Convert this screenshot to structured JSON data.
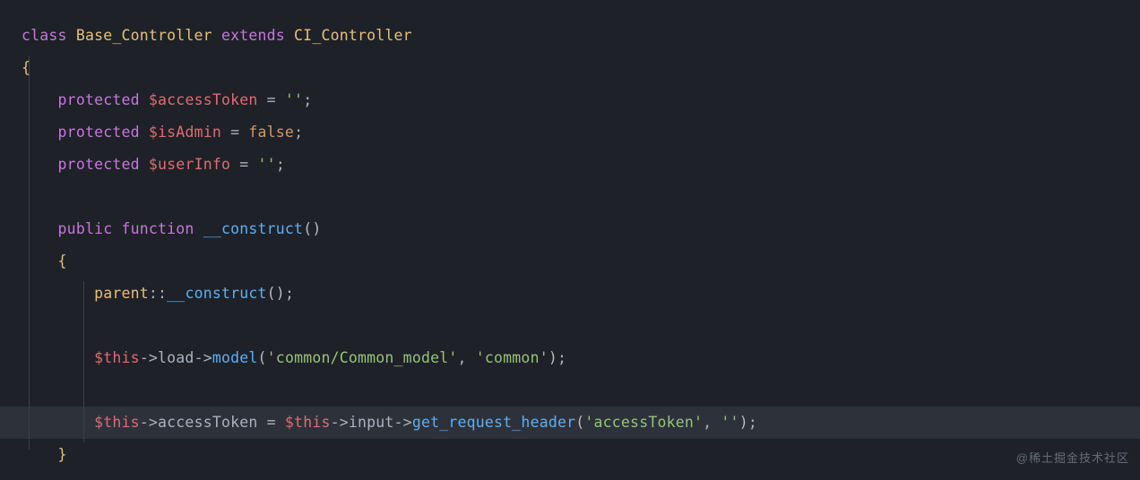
{
  "code": {
    "kw_class": "class",
    "class_name": "Base_Controller",
    "kw_extends": "extends",
    "parent_class": "CI_Controller",
    "brace_open": "{",
    "brace_close": "}",
    "props": {
      "p1_kw": "protected",
      "p1_var": "$accessToken",
      "p1_eq": " = ",
      "p1_val": "''",
      "p1_semi": ";",
      "p2_kw": "protected",
      "p2_var": "$isAdmin",
      "p2_eq": " = ",
      "p2_val": "false",
      "p2_semi": ";",
      "p3_kw": "protected",
      "p3_var": "$userInfo",
      "p3_eq": " = ",
      "p3_val": "''",
      "p3_semi": ";"
    },
    "ctor": {
      "kw_public": "public",
      "kw_function": "function",
      "name": "__construct",
      "parens": "()",
      "brace_open": "{",
      "brace_close": "}",
      "l1_parent": "parent",
      "l1_dcolon": "::",
      "l1_call": "__construct",
      "l1_parens": "()",
      "l1_semi": ";",
      "l2_this1": "$this",
      "l2_arrow1": "->",
      "l2_load": "load",
      "l2_arrow2": "->",
      "l2_model": "model",
      "l2_open": "(",
      "l2_arg1": "'common/Common_model'",
      "l2_comma": ", ",
      "l2_arg2": "'common'",
      "l2_close": ")",
      "l2_semi": ";",
      "l3_this1": "$this",
      "l3_arrow1": "->",
      "l3_prop": "accessToken",
      "l3_eq": " = ",
      "l3_this2": "$this",
      "l3_arrow2": "->",
      "l3_input": "input",
      "l3_arrow3": "->",
      "l3_fn": "get_request_header",
      "l3_open": "(",
      "l3_arg1": "'accessToken'",
      "l3_comma": ", ",
      "l3_arg2": "''",
      "l3_close": ")",
      "l3_semi": ";"
    }
  },
  "watermark": "@稀土掘金技术社区"
}
